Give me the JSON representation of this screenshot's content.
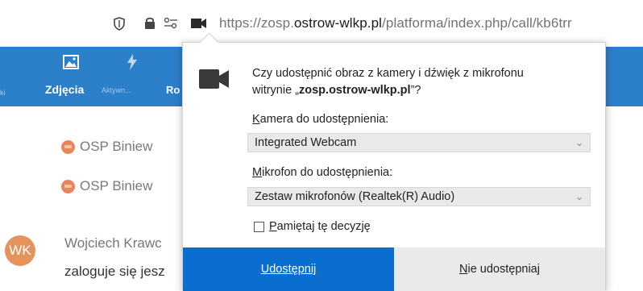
{
  "address_bar": {
    "url_prefix": "https://zosp.",
    "url_domain": "ostrow-wlkp.pl",
    "url_suffix": "/platforma/index.php/call/kb6trr",
    "icons": [
      "shield-icon",
      "lock-icon",
      "permissions-icon",
      "camera-icon"
    ]
  },
  "nav": {
    "left_fragment": "ki",
    "items": [
      {
        "label": "Zdjęcia",
        "icon": "image-icon",
        "active": true
      },
      {
        "label": "Aktywn...",
        "icon": "lightning-icon",
        "active": false
      }
    ],
    "partial_label": "Ro"
  },
  "content": {
    "posts": [
      {
        "author": "OSP Biniew"
      },
      {
        "author": "OSP Biniew"
      }
    ],
    "comment": {
      "avatar_initials": "WK",
      "author": "Wojciech Krawc",
      "text": "zaloguje się jesz"
    }
  },
  "permission_popup": {
    "prompt_line1": "Czy udostępnić obraz z kamery i dźwięk z mikrofonu",
    "prompt_line2_prefix": "witrynie „",
    "site": "zosp.ostrow-wlkp.pl",
    "prompt_line2_suffix": "”?",
    "camera": {
      "label_access": "K",
      "label_rest": "amera do udostępnienia:",
      "selected": "Integrated Webcam"
    },
    "microphone": {
      "label_access": "M",
      "label_rest": "ikrofon do udostępnienia:",
      "selected": "Zestaw mikrofonów (Realtek(R) Audio)"
    },
    "remember": {
      "label_access": "P",
      "label_rest": "amiętaj tę decyzję",
      "checked": false
    },
    "share_button": {
      "access": "U",
      "rest": "dostępnij"
    },
    "dont_share_button": {
      "access": "N",
      "rest": "ie udostępniaj"
    }
  },
  "colors": {
    "nav_bg": "#2c7fc9",
    "share_button_bg": "#0a6ed1",
    "dont_share_bg": "#eaeaea",
    "avatar_bg": "#e5935c",
    "post_icon": "#e8855a"
  }
}
